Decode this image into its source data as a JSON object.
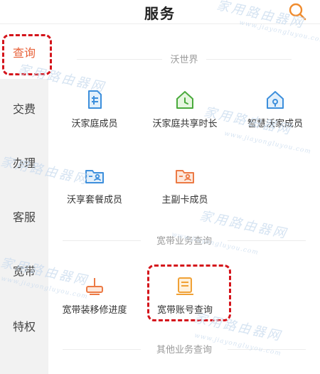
{
  "header": {
    "title": "服务",
    "search_icon": "search-icon"
  },
  "sidebar": {
    "active_color": "#e8623a",
    "items": [
      {
        "label": "查询",
        "active": true
      },
      {
        "label": "交费"
      },
      {
        "label": "办理"
      },
      {
        "label": "客服"
      },
      {
        "label": "宽带"
      },
      {
        "label": "特权"
      }
    ]
  },
  "sections": [
    {
      "title": "沃世界",
      "tiles": [
        {
          "label": "沃家庭成员",
          "icon": "document-icon"
        },
        {
          "label": "沃家庭共享时长",
          "icon": "home-clock-icon"
        },
        {
          "label": "智慧沃家成员",
          "icon": "smart-home-icon"
        },
        {
          "label": "沃享套餐成员",
          "icon": "folder-user-icon"
        },
        {
          "label": "主副卡成员",
          "icon": "card-user-icon"
        }
      ]
    },
    {
      "title": "宽带业务查询",
      "tiles": [
        {
          "label": "宽带装移修进度",
          "icon": "router-icon"
        },
        {
          "label": "宽带账号查询",
          "icon": "account-list-icon"
        }
      ]
    },
    {
      "title": "其他业务查询"
    }
  ],
  "watermark": {
    "brand": "家用路由器网",
    "url": "www.jiayongluyou.com"
  }
}
